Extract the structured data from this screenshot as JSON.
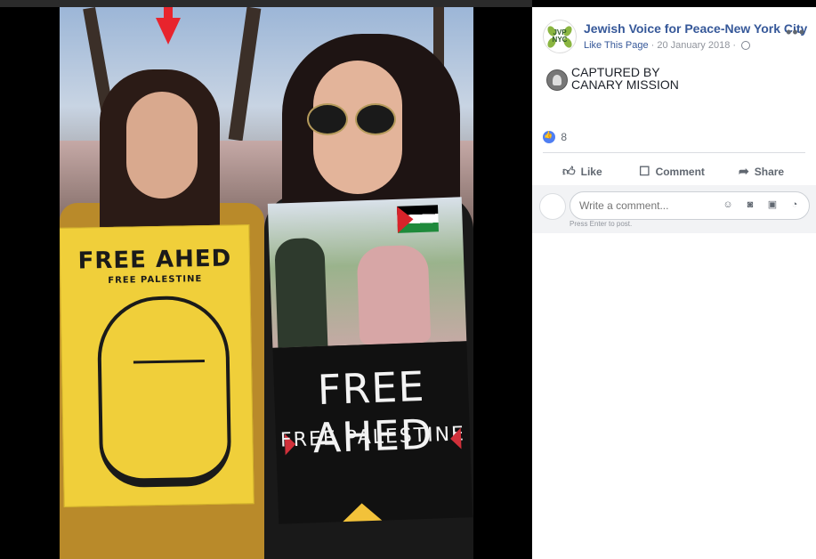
{
  "post": {
    "page_name": "Jewish Voice for Peace-New York City",
    "like_link": "Like This Page",
    "separator": "·",
    "date": "20 January 2018",
    "more_menu": "•••",
    "logo_text": "JVP\nNYC",
    "caption_line1": "CAPTURED BY",
    "caption_line2": "CANARY MISSION",
    "reaction_count": "8"
  },
  "actions": {
    "like": "Like",
    "comment": "Comment",
    "share": "Share"
  },
  "comment": {
    "placeholder": "Write a comment...",
    "hint": "Press Enter to post."
  },
  "photo": {
    "poster_yellow_title": "FREE AHED",
    "poster_yellow_sub": "FREE PALESTINE",
    "poster_dark_title": "FREE AHED",
    "poster_dark_sub": "FREE PALESTINE"
  },
  "icons": {
    "more": "ellipsis-icon",
    "globe": "globe-icon",
    "like": "thumbs-up-icon",
    "comment": "comment-icon",
    "share": "share-icon",
    "emoji": "emoji-icon",
    "camera": "camera-icon",
    "gif": "gif-icon",
    "sticker": "sticker-icon",
    "arrow": "red-arrow-icon"
  },
  "colors": {
    "link_blue": "#365899",
    "meta_gray": "#90949c",
    "reaction_blue": "#4f7ef2",
    "arrow_red": "#e8242d",
    "poster_yellow": "#f0cf3a"
  }
}
